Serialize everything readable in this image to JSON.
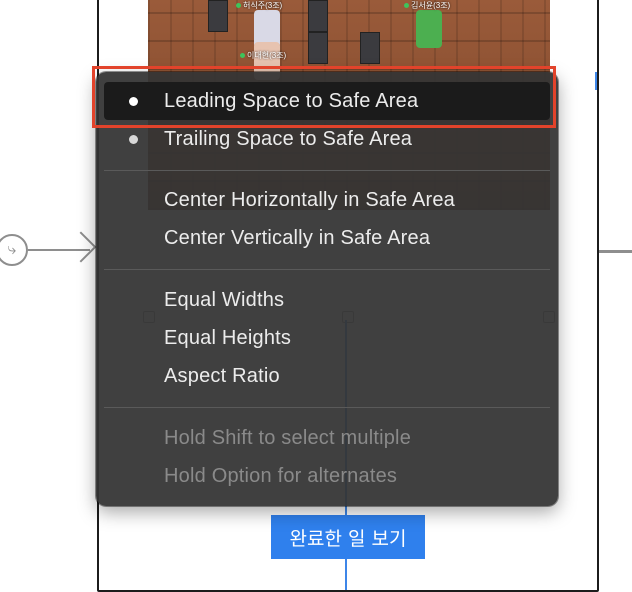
{
  "canvas": {
    "name_tags": [
      "허식주(3조)",
      "김서윤(3조)",
      "이대현(3조)"
    ]
  },
  "screen": {
    "action_button_label": "완료한 일 보기"
  },
  "menu": {
    "items": [
      {
        "label": "Leading Space to Safe Area",
        "checked": true,
        "highlighted": true
      },
      {
        "label": "Trailing Space to Safe Area",
        "checked": true,
        "highlighted": false
      },
      {
        "label": "Center Horizontally in Safe Area",
        "checked": false
      },
      {
        "label": "Center Vertically in Safe Area",
        "checked": false
      },
      {
        "label": "Equal Widths",
        "checked": false
      },
      {
        "label": "Equal Heights",
        "checked": false
      },
      {
        "label": "Aspect Ratio",
        "checked": false
      }
    ],
    "hints": [
      "Hold Shift to select multiple",
      "Hold Option for alternates"
    ]
  },
  "colors": {
    "menu_background": "#343434",
    "highlight": "#1b1b1b",
    "selection_outline": "#e2432b",
    "button_blue": "#2f80ed",
    "constraint_blue": "#3d86e8"
  }
}
